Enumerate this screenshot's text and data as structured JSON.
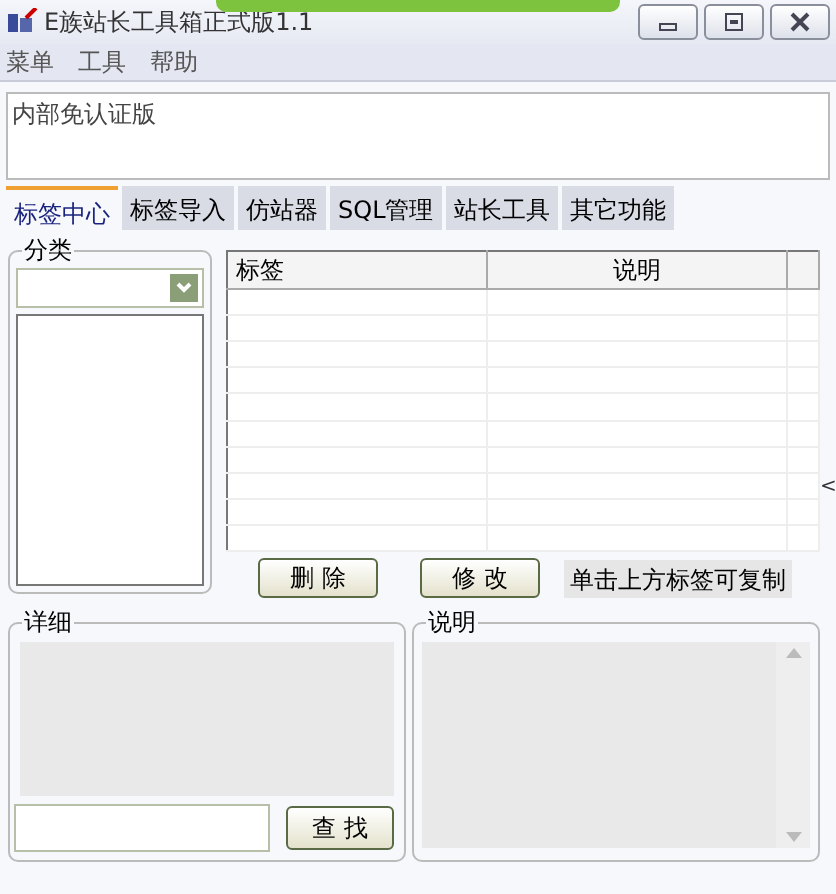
{
  "window": {
    "title": "E族站长工具箱正式版1.1"
  },
  "menu": [
    {
      "label": "菜单"
    },
    {
      "label": "工具"
    },
    {
      "label": "帮助"
    }
  ],
  "notice": {
    "value": "内部免认证版"
  },
  "tabs": [
    {
      "label": "标签中心",
      "selected": true
    },
    {
      "label": "标签导入",
      "selected": false
    },
    {
      "label": "仿站器",
      "selected": false
    },
    {
      "label": "SQL管理",
      "selected": false
    },
    {
      "label": "站长工具",
      "selected": false
    },
    {
      "label": "其它功能",
      "selected": false
    }
  ],
  "category": {
    "title": "分类"
  },
  "table": {
    "columns": [
      "标签",
      "说明"
    ]
  },
  "buttons": [
    {
      "label": "删 除"
    },
    {
      "label": "修 改"
    }
  ],
  "hint": "单击上方标签可复制",
  "side_mark": "<",
  "detail": {
    "title": "详细",
    "search_button": "查 找"
  },
  "description": {
    "title": "说明"
  }
}
